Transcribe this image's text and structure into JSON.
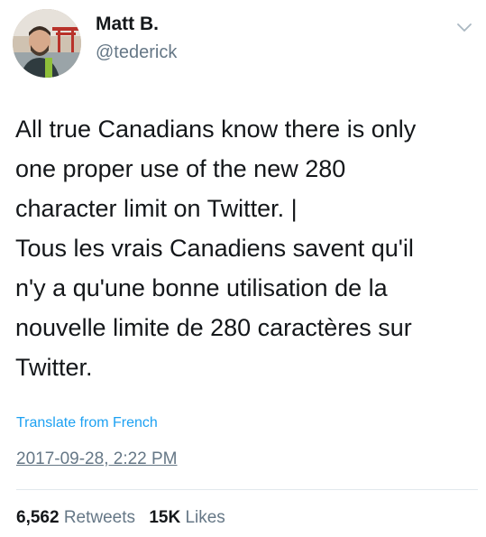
{
  "author": {
    "name": "Matt B.",
    "handle": "@tederick"
  },
  "tweet": {
    "lines": [
      "All true Canadians know there is only",
      "one proper use of the new 280",
      "character limit on Twitter. |",
      "Tous les vrais Canadiens savent qu'il",
      "n'y a qu'une bonne utilisation de la",
      "nouvelle limite de 280 caractères sur",
      "Twitter."
    ],
    "translate_label": "Translate from French",
    "timestamp": "2017-09-28, 2:22 PM"
  },
  "stats": {
    "retweets": {
      "count": "6,562",
      "label": "Retweets"
    },
    "likes": {
      "count": "15K",
      "label": "Likes"
    }
  },
  "icons": {
    "caret": "chevron-down-icon",
    "avatar": "avatar"
  },
  "colors": {
    "text": "#14171a",
    "secondary": "#657786",
    "link": "#1da1f2",
    "divider": "#e1e8ed"
  }
}
